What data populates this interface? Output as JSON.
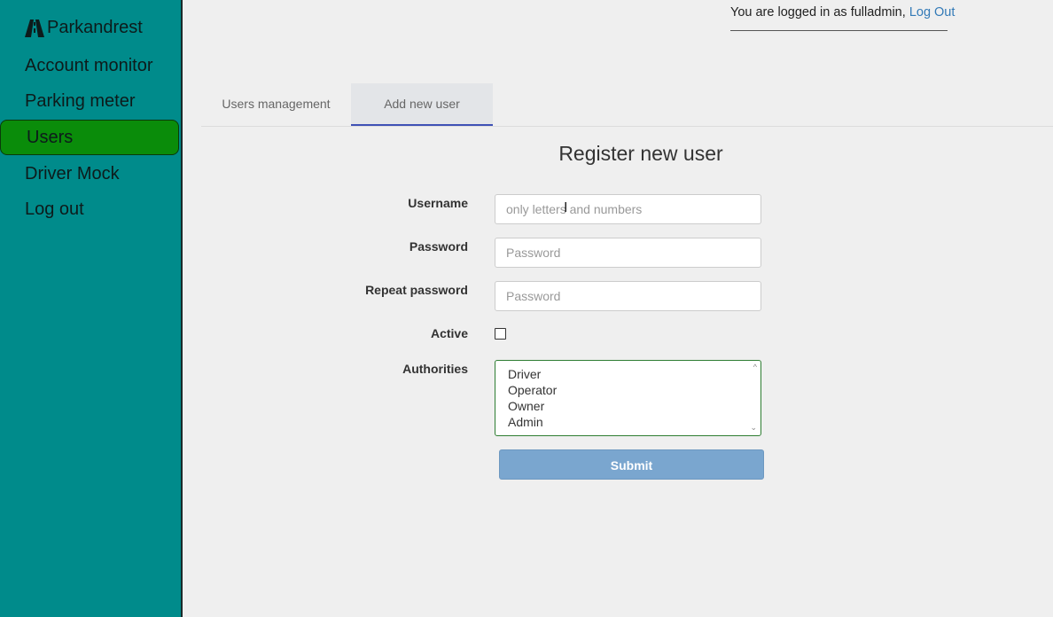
{
  "sidebar": {
    "brand": "Parkandrest",
    "items": [
      {
        "label": "Account monitor"
      },
      {
        "label": "Parking meter"
      },
      {
        "label": "Users"
      },
      {
        "label": "Driver Mock"
      },
      {
        "label": "Log out"
      }
    ],
    "active_color": "#0a8c0a",
    "background": "#008b8b"
  },
  "header": {
    "logged_in_text": "You are logged in as fulladmin,",
    "logout_link": "Log Out"
  },
  "tabs": [
    {
      "label": "Users management"
    },
    {
      "label": "Add new user"
    }
  ],
  "form": {
    "title": "Register new user",
    "username": {
      "label": "Username",
      "placeholder": "only letters and numbers",
      "value": ""
    },
    "password": {
      "label": "Password",
      "placeholder": "Password",
      "value": ""
    },
    "repeat_password": {
      "label": "Repeat password",
      "placeholder": "Password",
      "value": ""
    },
    "active": {
      "label": "Active",
      "checked": false
    },
    "authorities": {
      "label": "Authorities",
      "options": [
        "Driver",
        "Operator",
        "Owner",
        "Admin"
      ]
    },
    "submit_label": "Submit"
  },
  "icons": {
    "brand": "road-icon",
    "cursor": "text-cursor-icon"
  }
}
